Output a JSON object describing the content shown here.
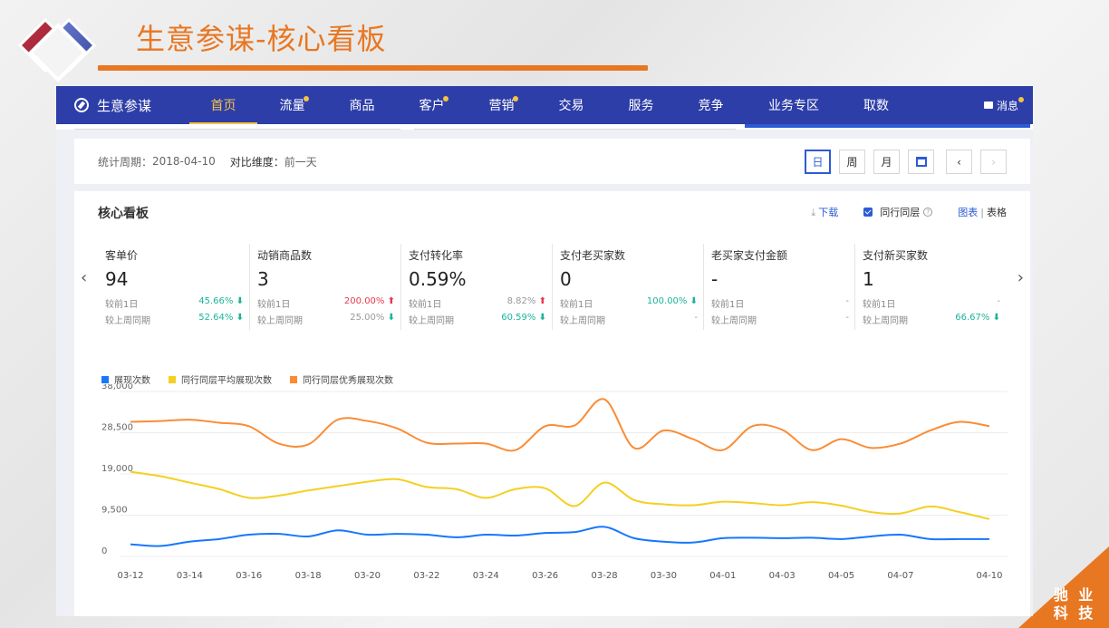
{
  "slide": {
    "title": "生意参谋-核心看板",
    "corner_line1": "驰 业",
    "corner_line2": "科 技",
    "accent": "#e87722"
  },
  "nav": {
    "brand": "生意参谋",
    "items": [
      {
        "label": "首页",
        "active": true,
        "dot": false
      },
      {
        "label": "流量",
        "active": false,
        "dot": true
      },
      {
        "label": "商品",
        "active": false,
        "dot": false
      },
      {
        "label": "客户",
        "active": false,
        "dot": true
      },
      {
        "label": "营销",
        "active": false,
        "dot": true
      },
      {
        "label": "交易",
        "active": false,
        "dot": false
      },
      {
        "label": "服务",
        "active": false,
        "dot": false
      },
      {
        "label": "竞争",
        "active": false,
        "dot": false
      },
      {
        "label": "业务专区",
        "active": false,
        "dot": false
      },
      {
        "label": "取数",
        "active": false,
        "dot": false
      }
    ],
    "message": "消息",
    "bg": "#2d3ea8",
    "highlight": "#f6c343"
  },
  "period": {
    "label": "统计周期：",
    "value": "2018-04-10",
    "compare_label": "对比维度：",
    "compare_value": "前一天",
    "buttons": {
      "day": "日",
      "week": "周",
      "month": "月",
      "prev": "‹",
      "next": "›"
    }
  },
  "panel": {
    "title": "核心看板",
    "download": "下载",
    "peer": "同行同层",
    "chart_link": "图表",
    "sep": "|",
    "table_link": "表格"
  },
  "metrics": [
    {
      "label": "客单价",
      "value": "94",
      "r1_label": "较前1日",
      "r1_value": "45.66%",
      "r1_dir": "down",
      "r2_label": "较上周同期",
      "r2_value": "52.64%",
      "r2_dir": "down"
    },
    {
      "label": "动销商品数",
      "value": "3",
      "r1_label": "较前1日",
      "r1_value": "200.00%",
      "r1_dir": "up",
      "r2_label": "较上周同期",
      "r2_value": "25.00%",
      "r2_dir": "down"
    },
    {
      "label": "支付转化率",
      "value": "0.59%",
      "r1_label": "较前1日",
      "r1_value": "8.82%",
      "r1_dir": "up",
      "r2_label": "较上周同期",
      "r2_value": "60.59%",
      "r2_dir": "down"
    },
    {
      "label": "支付老买家数",
      "value": "0",
      "r1_label": "较前1日",
      "r1_value": "100.00%",
      "r1_dir": "down",
      "r2_label": "较上周同期",
      "r2_value": "-",
      "r2_dir": "flat"
    },
    {
      "label": "老买家支付金额",
      "value": "-",
      "r1_label": "较前1日",
      "r1_value": "-",
      "r1_dir": "flat",
      "r2_label": "较上周同期",
      "r2_value": "-",
      "r2_dir": "flat"
    },
    {
      "label": "支付新买家数",
      "value": "1",
      "r1_label": "较前1日",
      "r1_value": "-",
      "r1_dir": "flat",
      "r2_label": "较上周同期",
      "r2_value": "66.67%",
      "r2_dir": "down"
    }
  ],
  "chart_data": {
    "type": "line",
    "title": "",
    "xlabel": "",
    "ylabel": "",
    "ylim": [
      0,
      38000
    ],
    "yticks": [
      0,
      9500,
      19000,
      28500,
      38000
    ],
    "ytick_labels": [
      "0",
      "9,500",
      "19,000",
      "28,500",
      "38,000"
    ],
    "xtick_labels": [
      "03-12",
      "03-14",
      "03-16",
      "03-18",
      "03-20",
      "03-22",
      "03-24",
      "03-26",
      "03-28",
      "03-30",
      "04-01",
      "04-03",
      "04-05",
      "04-07",
      "04-10"
    ],
    "grid": true,
    "legend": "top-left",
    "x": [
      "03-12",
      "03-13",
      "03-14",
      "03-15",
      "03-16",
      "03-17",
      "03-18",
      "03-19",
      "03-20",
      "03-21",
      "03-22",
      "03-23",
      "03-24",
      "03-25",
      "03-26",
      "03-27",
      "03-28",
      "03-29",
      "03-30",
      "03-31",
      "04-01",
      "04-02",
      "04-03",
      "04-04",
      "04-05",
      "04-06",
      "04-07",
      "04-08",
      "04-09",
      "04-10"
    ],
    "series": [
      {
        "name": "展现次数",
        "color": "#1677ff",
        "values": [
          2800,
          2400,
          3400,
          4000,
          5000,
          5200,
          4600,
          6000,
          5000,
          5200,
          5000,
          4400,
          5000,
          4800,
          5400,
          5600,
          6800,
          4200,
          3400,
          3200,
          4200,
          4300,
          4200,
          4300,
          4000,
          4600,
          5000,
          4000,
          4000,
          4000
        ]
      },
      {
        "name": "同行同层平均展现次数",
        "color": "#f5cf22",
        "values": [
          19500,
          18500,
          17000,
          15500,
          13500,
          14000,
          15200,
          16200,
          17200,
          17800,
          16000,
          15500,
          13500,
          15500,
          15700,
          11600,
          17000,
          13000,
          12000,
          11800,
          12600,
          12300,
          11800,
          12500,
          11700,
          10200,
          9900,
          11500,
          10200,
          8600
        ]
      },
      {
        "name": "同行同层优秀展现次数",
        "color": "#fa8c35",
        "values": [
          31000,
          31200,
          31500,
          30800,
          30000,
          26000,
          25800,
          31500,
          31200,
          29500,
          26200,
          26000,
          26000,
          24500,
          30000,
          30200,
          36200,
          25000,
          29000,
          27000,
          24500,
          30000,
          29200,
          24500,
          27000,
          25000,
          26000,
          29000,
          31000,
          30000
        ]
      }
    ]
  }
}
